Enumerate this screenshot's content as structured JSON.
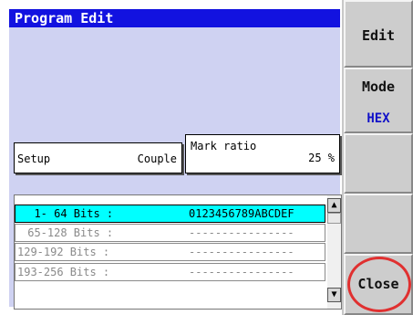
{
  "window": {
    "title": "Program Edit"
  },
  "setup": {
    "label": "Setup",
    "value": "Couple"
  },
  "mark_ratio": {
    "label": "Mark ratio",
    "value": "25 %"
  },
  "bits_list": {
    "rows": [
      {
        "label": "  1- 64 Bits :",
        "value": "0123456789ABCDEF",
        "selected": true
      },
      {
        "label": " 65-128 Bits :",
        "value": "----------------",
        "selected": false
      },
      {
        "label": "129-192 Bits :",
        "value": "----------------",
        "selected": false
      },
      {
        "label": "193-256 Bits :",
        "value": "----------------",
        "selected": false
      }
    ],
    "scroll_up_icon": "triangle-up",
    "scroll_down_icon": "triangle-down"
  },
  "side_buttons": {
    "edit": "Edit",
    "mode_label": "Mode",
    "mode_value": "HEX",
    "close": "Close"
  },
  "colors": {
    "title_bar": "#1212e0",
    "panel": "#cfd2f2",
    "selected_row": "#00ffff",
    "mode_value": "#1010c8",
    "highlight_ring": "#e03030"
  }
}
